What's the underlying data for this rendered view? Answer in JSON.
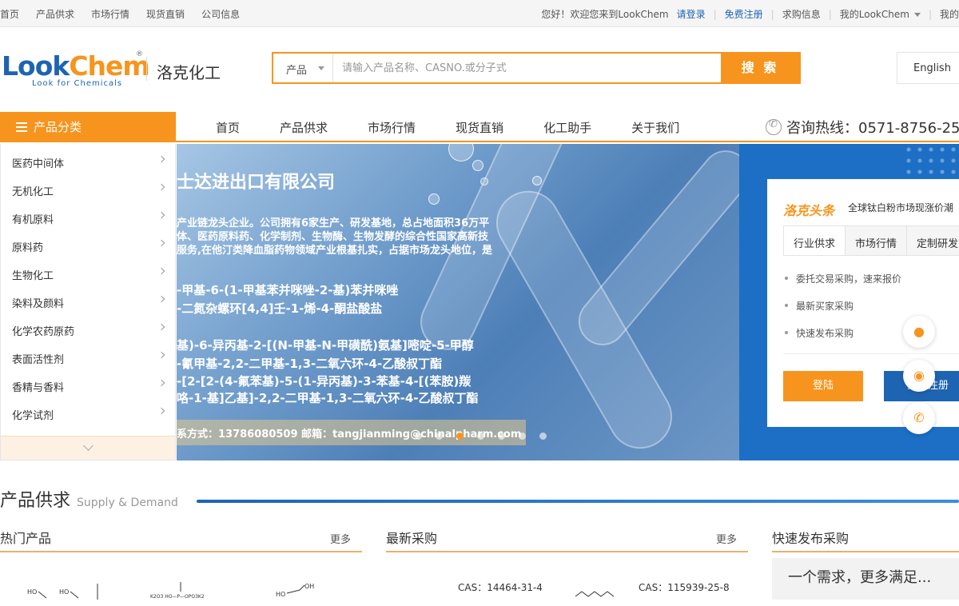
{
  "topbar": {
    "left_links": [
      "首页",
      "产品供求",
      "市场行情",
      "现货直销",
      "公司信息"
    ],
    "welcome": "您好！欢迎您来到LookChem",
    "login": "请登录",
    "register": "免费注册",
    "purchase_info": "求购信息",
    "my_lookchem": "我的LookChem"
  },
  "header": {
    "logo_look": "Look",
    "logo_chem": "Chem",
    "logo_tagline": "Look for Chemicals",
    "cn_name": "洛克化工",
    "search_type": "产品",
    "search_placeholder": "请输入产品名称、CASNO.或分子式",
    "search_button": "搜 索",
    "language": "English"
  },
  "nav": {
    "category_title": "产品分类",
    "items": [
      "首页",
      "产品供求",
      "市场行情",
      "现货直销",
      "化工助手",
      "关于我们"
    ],
    "hotline": "咨询热线：0571-8756-25"
  },
  "categories": [
    "医药中间体",
    "无机化工",
    "有机原料",
    "原料药",
    "生物化工",
    "染料及颜料",
    "化学农药原药",
    "表面活性剂",
    "香精与香料",
    "化学试剂"
  ],
  "banner": {
    "title": "士达进出口有限公司",
    "desc_lines": [
      "产业链龙头企业。公司拥有6家生产、研发基地，总占地面积36万平",
      "体、医药原料药、化学制剂、生物酶、生物发酵的综合性国家高新技",
      "服务,在他汀类降血脂药物领域产业根基扎实，占据市场龙头地位，是"
    ],
    "products": [
      "-甲基-6-(1-甲基苯并咪唑-2-基)苯并咪唑",
      "-二氮杂螺环[4,4]壬-1-烯-4-酮盐酸盐",
      "基)-6-异丙基-2-[(N-甲基-N-甲磺酰)氨基]嘧啶-5-甲醇",
      "-氰甲基-2,2-二甲基-1,3-二氧六环-4-乙酸叔丁酯",
      "-[2-[2-(4-氟苯基)-5-(1-异丙基)-3-苯基-4-[(苯胺)羰",
      "咯-1-基]乙基]-2,2-二甲基-1,3-二氧六环-4-乙酸叔丁酯"
    ],
    "contact": "系方式：13786080509     邮箱：tangjianming@chinalpharm.com",
    "slide_count": 7,
    "active_slide": 2
  },
  "right_card": {
    "brand": "洛克头条",
    "headline": "全球钛白粉市场现涨价潮",
    "tabs": [
      "行业供求",
      "市场行情",
      "定制研发"
    ],
    "list": [
      "委托交易采购，速来报价",
      "最新买家采购",
      "快速发布采购"
    ],
    "login_button": "登陆",
    "register_button": "免费注册"
  },
  "section": {
    "title": "产品供求",
    "subtitle": "Supply & Demand"
  },
  "columns": {
    "hot_products": "热门产品",
    "latest_purchase": "最新采购",
    "quick_publish": "快速发布采购",
    "more": "更多"
  },
  "purchase_items": [
    {
      "cas": "CAS：14464-31-4"
    },
    {
      "cas": "CAS：115939-25-8"
    }
  ],
  "quick_box_text": "一个需求，更多满足...",
  "colors": {
    "accent": "#f7941d",
    "brand_blue": "#1d64b3"
  },
  "icons": {
    "qq": "qq-icon",
    "wechat": "wechat-icon",
    "phone": "phone-icon"
  }
}
